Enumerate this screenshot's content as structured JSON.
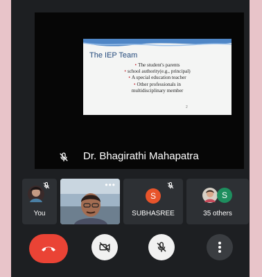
{
  "presentation": {
    "slide_title": "The IEP Team",
    "bullets": [
      "The student's parents",
      "school authority(e.g., principal)",
      "A special education teacher",
      "Other professionals in multidisciplinary member"
    ],
    "slide_number": "2"
  },
  "speaker": {
    "name": "Dr. Bhagirathi Mahapatra"
  },
  "participants": [
    {
      "label": "You"
    },
    {
      "label": ""
    },
    {
      "label": "SUBHASREE",
      "initial": "S"
    },
    {
      "label": "35 others",
      "initial": "S"
    }
  ],
  "colors": {
    "background": "#1d1f22",
    "tile": "#2d3034",
    "end_call": "#ea4335",
    "subhasree_avatar": "#e8542b",
    "others_avatar": "#1e8e5e"
  },
  "icons": {
    "main_mic": "mic-off-icon",
    "end_call": "phone-hangup-icon",
    "camera": "video-off-icon",
    "mic_toggle": "mic-off-icon",
    "more": "more-vertical-icon"
  }
}
